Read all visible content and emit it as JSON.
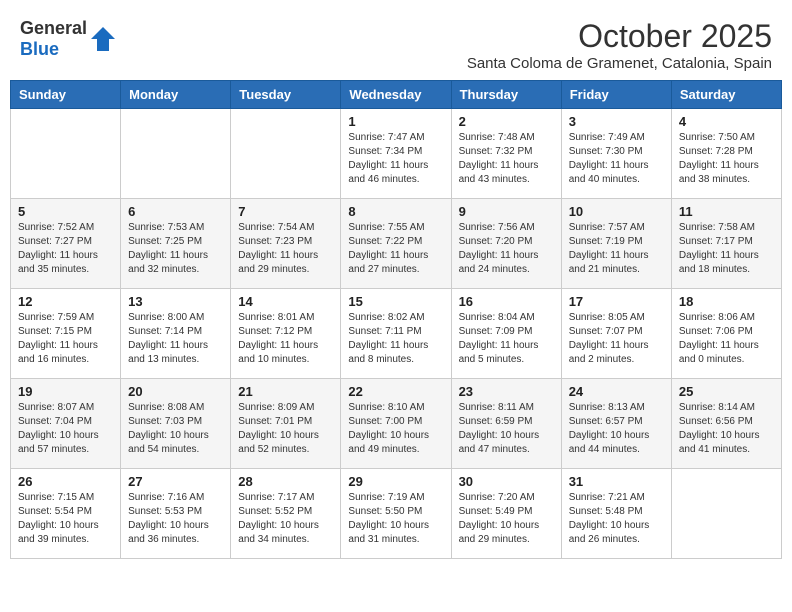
{
  "header": {
    "logo_general": "General",
    "logo_blue": "Blue",
    "month_year": "October 2025",
    "location": "Santa Coloma de Gramenet, Catalonia, Spain"
  },
  "weekdays": [
    "Sunday",
    "Monday",
    "Tuesday",
    "Wednesday",
    "Thursday",
    "Friday",
    "Saturday"
  ],
  "weeks": [
    [
      {
        "day": "",
        "sunrise": "",
        "sunset": "",
        "daylight": ""
      },
      {
        "day": "",
        "sunrise": "",
        "sunset": "",
        "daylight": ""
      },
      {
        "day": "",
        "sunrise": "",
        "sunset": "",
        "daylight": ""
      },
      {
        "day": "1",
        "sunrise": "Sunrise: 7:47 AM",
        "sunset": "Sunset: 7:34 PM",
        "daylight": "Daylight: 11 hours and 46 minutes."
      },
      {
        "day": "2",
        "sunrise": "Sunrise: 7:48 AM",
        "sunset": "Sunset: 7:32 PM",
        "daylight": "Daylight: 11 hours and 43 minutes."
      },
      {
        "day": "3",
        "sunrise": "Sunrise: 7:49 AM",
        "sunset": "Sunset: 7:30 PM",
        "daylight": "Daylight: 11 hours and 40 minutes."
      },
      {
        "day": "4",
        "sunrise": "Sunrise: 7:50 AM",
        "sunset": "Sunset: 7:28 PM",
        "daylight": "Daylight: 11 hours and 38 minutes."
      }
    ],
    [
      {
        "day": "5",
        "sunrise": "Sunrise: 7:52 AM",
        "sunset": "Sunset: 7:27 PM",
        "daylight": "Daylight: 11 hours and 35 minutes."
      },
      {
        "day": "6",
        "sunrise": "Sunrise: 7:53 AM",
        "sunset": "Sunset: 7:25 PM",
        "daylight": "Daylight: 11 hours and 32 minutes."
      },
      {
        "day": "7",
        "sunrise": "Sunrise: 7:54 AM",
        "sunset": "Sunset: 7:23 PM",
        "daylight": "Daylight: 11 hours and 29 minutes."
      },
      {
        "day": "8",
        "sunrise": "Sunrise: 7:55 AM",
        "sunset": "Sunset: 7:22 PM",
        "daylight": "Daylight: 11 hours and 27 minutes."
      },
      {
        "day": "9",
        "sunrise": "Sunrise: 7:56 AM",
        "sunset": "Sunset: 7:20 PM",
        "daylight": "Daylight: 11 hours and 24 minutes."
      },
      {
        "day": "10",
        "sunrise": "Sunrise: 7:57 AM",
        "sunset": "Sunset: 7:19 PM",
        "daylight": "Daylight: 11 hours and 21 minutes."
      },
      {
        "day": "11",
        "sunrise": "Sunrise: 7:58 AM",
        "sunset": "Sunset: 7:17 PM",
        "daylight": "Daylight: 11 hours and 18 minutes."
      }
    ],
    [
      {
        "day": "12",
        "sunrise": "Sunrise: 7:59 AM",
        "sunset": "Sunset: 7:15 PM",
        "daylight": "Daylight: 11 hours and 16 minutes."
      },
      {
        "day": "13",
        "sunrise": "Sunrise: 8:00 AM",
        "sunset": "Sunset: 7:14 PM",
        "daylight": "Daylight: 11 hours and 13 minutes."
      },
      {
        "day": "14",
        "sunrise": "Sunrise: 8:01 AM",
        "sunset": "Sunset: 7:12 PM",
        "daylight": "Daylight: 11 hours and 10 minutes."
      },
      {
        "day": "15",
        "sunrise": "Sunrise: 8:02 AM",
        "sunset": "Sunset: 7:11 PM",
        "daylight": "Daylight: 11 hours and 8 minutes."
      },
      {
        "day": "16",
        "sunrise": "Sunrise: 8:04 AM",
        "sunset": "Sunset: 7:09 PM",
        "daylight": "Daylight: 11 hours and 5 minutes."
      },
      {
        "day": "17",
        "sunrise": "Sunrise: 8:05 AM",
        "sunset": "Sunset: 7:07 PM",
        "daylight": "Daylight: 11 hours and 2 minutes."
      },
      {
        "day": "18",
        "sunrise": "Sunrise: 8:06 AM",
        "sunset": "Sunset: 7:06 PM",
        "daylight": "Daylight: 11 hours and 0 minutes."
      }
    ],
    [
      {
        "day": "19",
        "sunrise": "Sunrise: 8:07 AM",
        "sunset": "Sunset: 7:04 PM",
        "daylight": "Daylight: 10 hours and 57 minutes."
      },
      {
        "day": "20",
        "sunrise": "Sunrise: 8:08 AM",
        "sunset": "Sunset: 7:03 PM",
        "daylight": "Daylight: 10 hours and 54 minutes."
      },
      {
        "day": "21",
        "sunrise": "Sunrise: 8:09 AM",
        "sunset": "Sunset: 7:01 PM",
        "daylight": "Daylight: 10 hours and 52 minutes."
      },
      {
        "day": "22",
        "sunrise": "Sunrise: 8:10 AM",
        "sunset": "Sunset: 7:00 PM",
        "daylight": "Daylight: 10 hours and 49 minutes."
      },
      {
        "day": "23",
        "sunrise": "Sunrise: 8:11 AM",
        "sunset": "Sunset: 6:59 PM",
        "daylight": "Daylight: 10 hours and 47 minutes."
      },
      {
        "day": "24",
        "sunrise": "Sunrise: 8:13 AM",
        "sunset": "Sunset: 6:57 PM",
        "daylight": "Daylight: 10 hours and 44 minutes."
      },
      {
        "day": "25",
        "sunrise": "Sunrise: 8:14 AM",
        "sunset": "Sunset: 6:56 PM",
        "daylight": "Daylight: 10 hours and 41 minutes."
      }
    ],
    [
      {
        "day": "26",
        "sunrise": "Sunrise: 7:15 AM",
        "sunset": "Sunset: 5:54 PM",
        "daylight": "Daylight: 10 hours and 39 minutes."
      },
      {
        "day": "27",
        "sunrise": "Sunrise: 7:16 AM",
        "sunset": "Sunset: 5:53 PM",
        "daylight": "Daylight: 10 hours and 36 minutes."
      },
      {
        "day": "28",
        "sunrise": "Sunrise: 7:17 AM",
        "sunset": "Sunset: 5:52 PM",
        "daylight": "Daylight: 10 hours and 34 minutes."
      },
      {
        "day": "29",
        "sunrise": "Sunrise: 7:19 AM",
        "sunset": "Sunset: 5:50 PM",
        "daylight": "Daylight: 10 hours and 31 minutes."
      },
      {
        "day": "30",
        "sunrise": "Sunrise: 7:20 AM",
        "sunset": "Sunset: 5:49 PM",
        "daylight": "Daylight: 10 hours and 29 minutes."
      },
      {
        "day": "31",
        "sunrise": "Sunrise: 7:21 AM",
        "sunset": "Sunset: 5:48 PM",
        "daylight": "Daylight: 10 hours and 26 minutes."
      },
      {
        "day": "",
        "sunrise": "",
        "sunset": "",
        "daylight": ""
      }
    ]
  ]
}
